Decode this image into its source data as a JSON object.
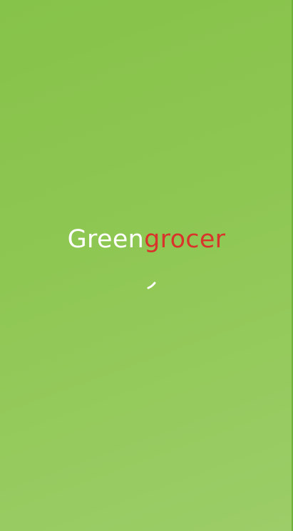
{
  "app": {
    "brand_part1": "Green",
    "brand_part2": "grocer"
  },
  "colors": {
    "background_top": "#86c34a",
    "background_bottom": "#9ccd68",
    "brand_part1": "#ffffff",
    "brand_part2": "#d8342b",
    "spinner": "#ffffff"
  },
  "loading_indicator": {
    "icon": "loading-spinner-icon"
  }
}
